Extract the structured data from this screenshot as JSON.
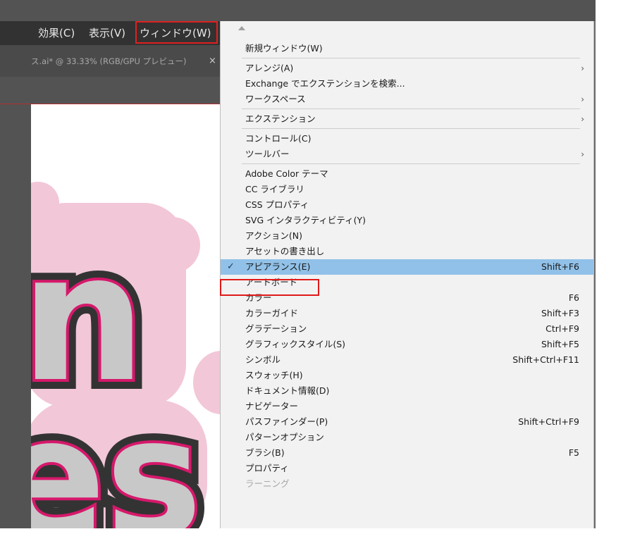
{
  "menubar": {
    "items": [
      {
        "label": "効果(C)"
      },
      {
        "label": "表示(V)"
      },
      {
        "label": "ウィンドウ(W)"
      }
    ]
  },
  "document_tab": {
    "title": "ス.ai* @ 33.33% (RGB/GPU プレビュー)",
    "close": "×"
  },
  "canvas": {
    "line1": "n",
    "line2": "es",
    "colors": {
      "fill": "#c8c8c8",
      "pink_stroke": "#d6186b",
      "outline": "#333333",
      "halo": "#f2c7d8"
    }
  },
  "window_menu": {
    "items": [
      {
        "label": "新規ウィンドウ(W)",
        "shortcut": "",
        "submenu": false
      },
      {
        "label": "アレンジ(A)",
        "shortcut": "",
        "submenu": true
      },
      {
        "label": "Exchange でエクステンションを検索...",
        "shortcut": "",
        "submenu": false
      },
      {
        "label": "ワークスペース",
        "shortcut": "",
        "submenu": true
      },
      {
        "label": "エクステンション",
        "shortcut": "",
        "submenu": true
      },
      {
        "label": "コントロール(C)",
        "shortcut": "",
        "submenu": false
      },
      {
        "label": "ツールバー",
        "shortcut": "",
        "submenu": true
      },
      {
        "label": "Adobe Color テーマ",
        "shortcut": "",
        "submenu": false
      },
      {
        "label": "CC ライブラリ",
        "shortcut": "",
        "submenu": false
      },
      {
        "label": "CSS プロパティ",
        "shortcut": "",
        "submenu": false
      },
      {
        "label": "SVG インタラクティビティ(Y)",
        "shortcut": "",
        "submenu": false
      },
      {
        "label": "アクション(N)",
        "shortcut": "",
        "submenu": false
      },
      {
        "label": "アセットの書き出し",
        "shortcut": "",
        "submenu": false
      },
      {
        "label": "アピアランス(E)",
        "shortcut": "Shift+F6",
        "submenu": false,
        "checked": true,
        "highlighted": true
      },
      {
        "label": "アートボード",
        "shortcut": "",
        "submenu": false
      },
      {
        "label": "カラー",
        "shortcut": "F6",
        "submenu": false
      },
      {
        "label": "カラーガイド",
        "shortcut": "Shift+F3",
        "submenu": false
      },
      {
        "label": "グラデーション",
        "shortcut": "Ctrl+F9",
        "submenu": false
      },
      {
        "label": "グラフィックスタイル(S)",
        "shortcut": "Shift+F5",
        "submenu": false
      },
      {
        "label": "シンボル",
        "shortcut": "Shift+Ctrl+F11",
        "submenu": false
      },
      {
        "label": "スウォッチ(H)",
        "shortcut": "",
        "submenu": false
      },
      {
        "label": "ドキュメント情報(D)",
        "shortcut": "",
        "submenu": false
      },
      {
        "label": "ナビゲーター",
        "shortcut": "",
        "submenu": false
      },
      {
        "label": "パスファインダー(P)",
        "shortcut": "Shift+Ctrl+F9",
        "submenu": false
      },
      {
        "label": "パターンオプション",
        "shortcut": "",
        "submenu": false
      },
      {
        "label": "ブラシ(B)",
        "shortcut": "F5",
        "submenu": false
      },
      {
        "label": "プロパティ",
        "shortcut": "",
        "submenu": false
      },
      {
        "label": "ラーニング",
        "shortcut": "",
        "submenu": false,
        "disabled": true
      }
    ],
    "checkmark": "✓",
    "submenu_arrow": "›",
    "highlight_color": "#91c1e8",
    "annotation_color": "#e01a1a"
  }
}
